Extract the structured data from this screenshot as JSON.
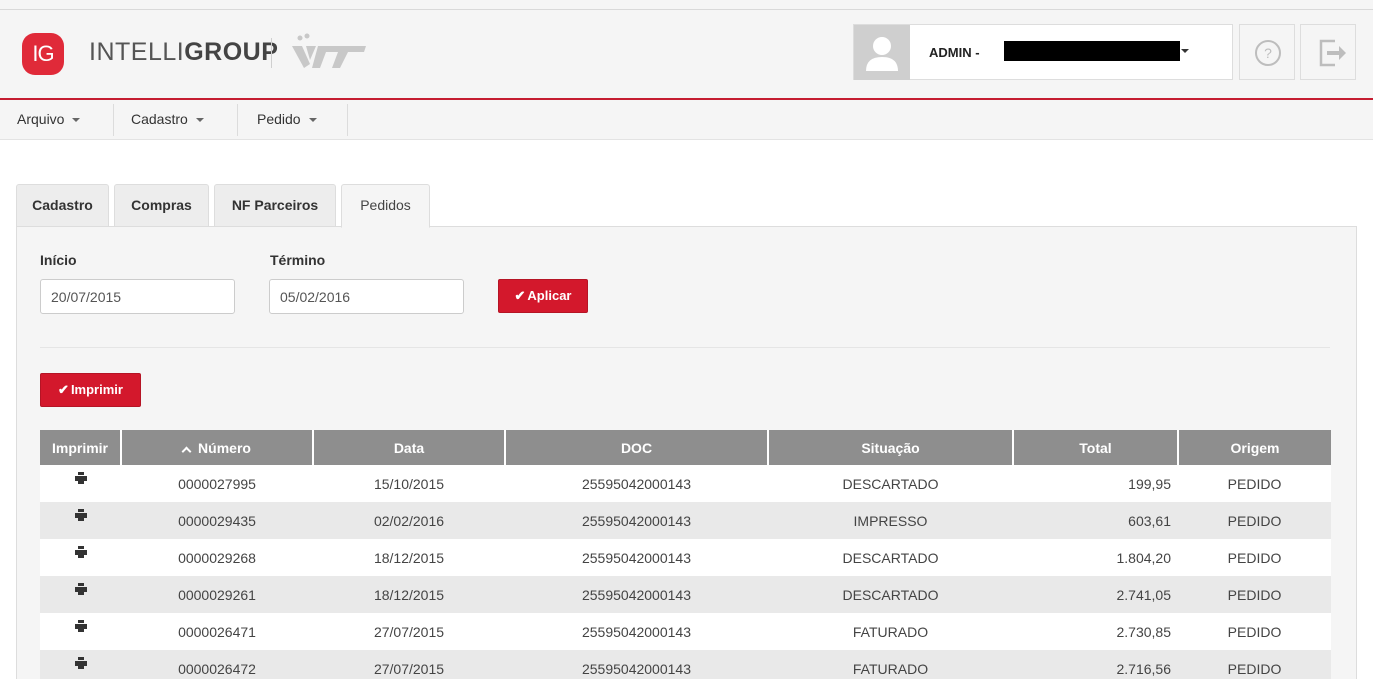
{
  "header": {
    "logo_badge": "IG",
    "brand_light": "INTELLI",
    "brand_bold": "GROUP",
    "partner_logo": "VT logo",
    "user_label": "ADMIN -"
  },
  "menu": [
    {
      "label": "Arquivo"
    },
    {
      "label": "Cadastro"
    },
    {
      "label": "Pedido"
    }
  ],
  "tabs": [
    {
      "label": "Cadastro"
    },
    {
      "label": "Compras"
    },
    {
      "label": "NF Parceiros"
    },
    {
      "label": "Pedidos"
    }
  ],
  "filters": {
    "inicio_label": "Início",
    "inicio_value": "20/07/2015",
    "termino_label": "Término",
    "termino_value": "05/02/2016",
    "apply_label": "Aplicar",
    "print_label": "Imprimir"
  },
  "table": {
    "columns": [
      "Imprimir",
      "Número",
      "Data",
      "DOC",
      "Situação",
      "Total",
      "Origem"
    ],
    "rows": [
      {
        "numero": "0000027995",
        "data": "15/10/2015",
        "doc": "25595042000143",
        "situacao": "DESCARTADO",
        "total": "199,95",
        "origem": "PEDIDO"
      },
      {
        "numero": "0000029435",
        "data": "02/02/2016",
        "doc": "25595042000143",
        "situacao": "IMPRESSO",
        "total": "603,61",
        "origem": "PEDIDO"
      },
      {
        "numero": "0000029268",
        "data": "18/12/2015",
        "doc": "25595042000143",
        "situacao": "DESCARTADO",
        "total": "1.804,20",
        "origem": "PEDIDO"
      },
      {
        "numero": "0000029261",
        "data": "18/12/2015",
        "doc": "25595042000143",
        "situacao": "DESCARTADO",
        "total": "2.741,05",
        "origem": "PEDIDO"
      },
      {
        "numero": "0000026471",
        "data": "27/07/2015",
        "doc": "25595042000143",
        "situacao": "FATURADO",
        "total": "2.730,85",
        "origem": "PEDIDO"
      },
      {
        "numero": "0000026472",
        "data": "27/07/2015",
        "doc": "25595042000143",
        "situacao": "FATURADO",
        "total": "2.716,56",
        "origem": "PEDIDO"
      }
    ]
  },
  "colors": {
    "brand_red": "#d3182c",
    "header_line": "#c51d31",
    "table_header": "#8e8e8e"
  },
  "icons": {
    "help": "help-icon",
    "logout": "logout-icon",
    "row_print": "printer-icon",
    "user": "user-avatar-icon"
  }
}
